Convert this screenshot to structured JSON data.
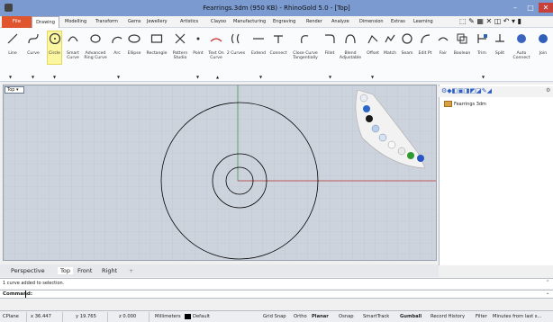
{
  "window": {
    "title": "Fearrings.3dm (950 KB) - RhinoGold 5.0 - [Top]",
    "app_icon": "rhino-icon"
  },
  "menu": {
    "items": [
      "File",
      "Drawing",
      "Modelling",
      "Transform",
      "Gems",
      "Jewellery",
      "Artistics",
      "Clayoo",
      "Manufacturing",
      "Engraving",
      "Render",
      "Analyze",
      "Dimension",
      "Extras",
      "Learning"
    ],
    "active": "Drawing"
  },
  "ribbon": {
    "tools": [
      "Line",
      "Curve",
      "Circle",
      "Smart Curve",
      "Advanced Ring Curve",
      "Arc",
      "Ellipse",
      "Rectangle",
      "Pattern Studio",
      "Point",
      "Text On Curve",
      "2 Curves",
      "Extend",
      "Connect",
      "Close Curve Tangentially",
      "Fillet",
      "Blend Adjustable",
      "Offset",
      "Match",
      "Seam",
      "Edit Pt",
      "Fair",
      "Boolean",
      "Trim",
      "Split",
      "Auto Connect",
      "Join"
    ],
    "active_tool": "Circle",
    "accent": "#fbf6a1"
  },
  "viewport": {
    "label": "Top",
    "background": "#cdd3dc",
    "x_axis_color": "#b03030",
    "y_axis_color": "#3a9a3a"
  },
  "panel": {
    "layer_name": "Fearrings 3dm"
  },
  "viewport_tabs": {
    "tabs": [
      "Perspective",
      "Top",
      "Front",
      "Right"
    ],
    "add": "+",
    "active": "Top"
  },
  "command": {
    "history": "1 curve added to selection.",
    "prompt": "Command:"
  },
  "status": {
    "cplane": "CPlane",
    "x": "x 36.447",
    "y": "y 19.765",
    "z": "z 0.000",
    "units": "Millimeters",
    "layer": "Default",
    "toggles": [
      "Grid Snap",
      "Ortho",
      "Planar",
      "Osnap",
      "SmartTrack",
      "Gumball",
      "Record History",
      "Filter"
    ],
    "bold": [
      "Planar",
      "Gumball"
    ],
    "info": "Minutes from last s..."
  }
}
